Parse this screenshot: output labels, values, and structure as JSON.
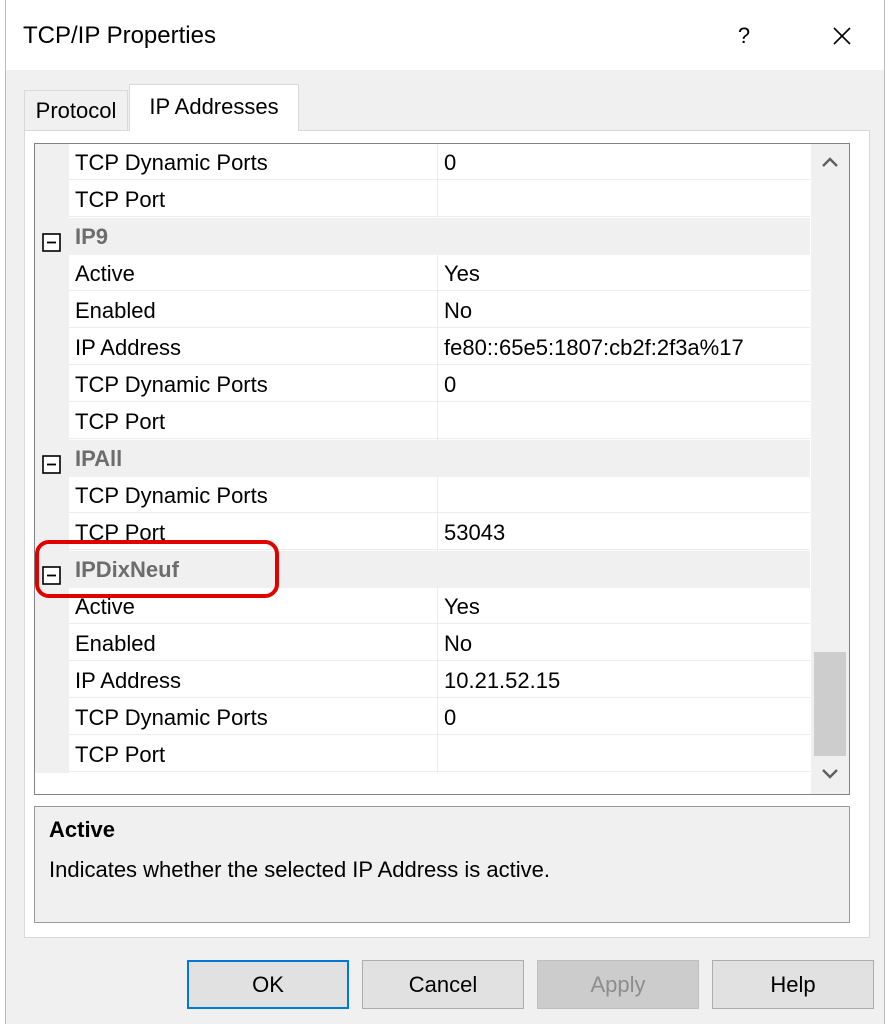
{
  "window": {
    "title": "TCP/IP Properties",
    "help_label": "?",
    "close_icon": "close-icon"
  },
  "tabs": [
    {
      "label": "Protocol",
      "active": false
    },
    {
      "label": "IP Addresses",
      "active": true
    }
  ],
  "grid": {
    "rows": [
      {
        "kind": "prop",
        "name": "TCP Dynamic Ports",
        "value": "0"
      },
      {
        "kind": "prop",
        "name": "TCP Port",
        "value": ""
      },
      {
        "kind": "cat",
        "name": "IP9",
        "icon": "collapse-icon"
      },
      {
        "kind": "prop",
        "name": "Active",
        "value": "Yes"
      },
      {
        "kind": "prop",
        "name": "Enabled",
        "value": "No"
      },
      {
        "kind": "prop",
        "name": "IP Address",
        "value": "fe80::65e5:1807:cb2f:2f3a%17"
      },
      {
        "kind": "prop",
        "name": "TCP Dynamic Ports",
        "value": "0"
      },
      {
        "kind": "prop",
        "name": "TCP Port",
        "value": ""
      },
      {
        "kind": "cat",
        "name": "IPAll",
        "icon": "collapse-icon"
      },
      {
        "kind": "prop",
        "name": "TCP Dynamic Ports",
        "value": ""
      },
      {
        "kind": "prop",
        "name": "TCP Port",
        "value": "53043"
      },
      {
        "kind": "cat",
        "name": "IPDixNeuf",
        "icon": "collapse-icon",
        "highlighted": true
      },
      {
        "kind": "prop",
        "name": "Active",
        "value": "Yes"
      },
      {
        "kind": "prop",
        "name": "Enabled",
        "value": "No"
      },
      {
        "kind": "prop",
        "name": "IP Address",
        "value": "10.21.52.15"
      },
      {
        "kind": "prop",
        "name": "TCP Dynamic Ports",
        "value": "0"
      },
      {
        "kind": "prop",
        "name": "TCP Port",
        "value": ""
      }
    ],
    "scroll_position": 0.84
  },
  "description": {
    "title": "Active",
    "text": "Indicates whether the selected IP Address is active."
  },
  "buttons": {
    "ok": "OK",
    "cancel": "Cancel",
    "apply": "Apply",
    "help": "Help"
  },
  "colors": {
    "highlight": "#e00000",
    "category_text": "#6d6d6d",
    "default_button_border": "#0078d7"
  }
}
